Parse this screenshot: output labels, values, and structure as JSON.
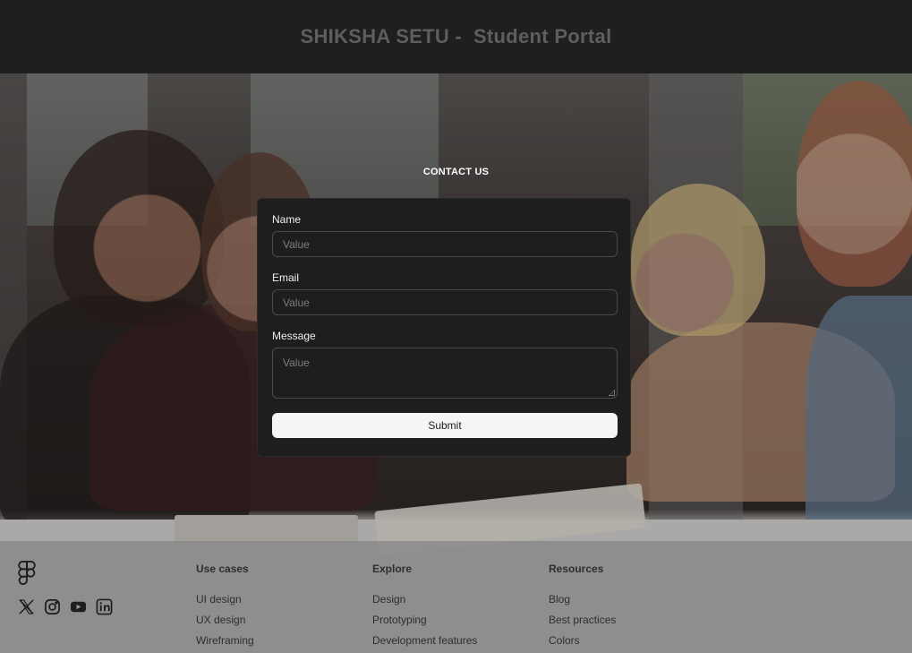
{
  "header": {
    "title": "SHIKSHA SETU -  Student Portal"
  },
  "contact": {
    "heading": "CONTACT US",
    "fields": {
      "name": {
        "label": "Name",
        "placeholder": "Value"
      },
      "email": {
        "label": "Email",
        "placeholder": "Value"
      },
      "message": {
        "label": "Message",
        "placeholder": "Value"
      }
    },
    "submit_label": "Submit"
  },
  "footer": {
    "logo_icon": "figma-logo-icon",
    "socials": [
      "x-icon",
      "instagram-icon",
      "youtube-icon",
      "linkedin-icon"
    ],
    "columns": [
      {
        "title": "Use cases",
        "links": [
          "UI design",
          "UX design",
          "Wireframing"
        ]
      },
      {
        "title": "Explore",
        "links": [
          "Design",
          "Prototyping",
          "Development features"
        ]
      },
      {
        "title": "Resources",
        "links": [
          "Blog",
          "Best practices",
          "Colors"
        ]
      }
    ]
  },
  "colors": {
    "header_bg": "#1f1f1f",
    "title_text": "#5e5e5e",
    "card_bg": "#1e1e1e",
    "button_bg": "#f5f5f5"
  }
}
